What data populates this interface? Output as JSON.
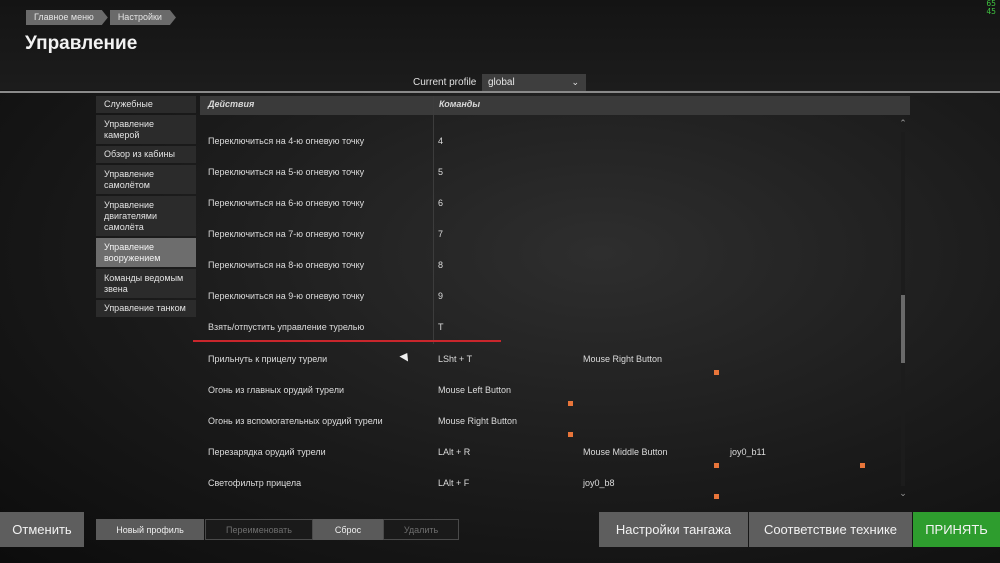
{
  "breadcrumbs": [
    "Главное меню",
    "Настройки"
  ],
  "page_title": "Управление",
  "fps_counter": [
    "65",
    "45"
  ],
  "profile": {
    "label": "Current profile",
    "value": "global"
  },
  "sidebar": {
    "items": [
      {
        "label": "Служебные",
        "active": false
      },
      {
        "label": "Управление камерой",
        "active": false
      },
      {
        "label": "Обзор из кабины",
        "active": false
      },
      {
        "label": "Управление самолётом",
        "active": false
      },
      {
        "label": "Управление двигателями самолёта",
        "active": false
      },
      {
        "label": "Управление вооружением",
        "active": true
      },
      {
        "label": "Команды ведомым звена",
        "active": false
      },
      {
        "label": "Управление танком",
        "active": false
      }
    ]
  },
  "table": {
    "headers": {
      "actions": "Действия",
      "commands": "Команды"
    },
    "rows": [
      {
        "action": "Переключиться на 4-ю огневую точку",
        "cmd1": "4",
        "cmd2": "",
        "cmd3": ""
      },
      {
        "action": "Переключиться на 5-ю огневую точку",
        "cmd1": "5",
        "cmd2": "",
        "cmd3": ""
      },
      {
        "action": "Переключиться на 6-ю огневую точку",
        "cmd1": "6",
        "cmd2": "",
        "cmd3": ""
      },
      {
        "action": "Переключиться на 7-ю огневую точку",
        "cmd1": "7",
        "cmd2": "",
        "cmd3": ""
      },
      {
        "action": "Переключиться на 8-ю огневую точку",
        "cmd1": "8",
        "cmd2": "",
        "cmd3": ""
      },
      {
        "action": "Переключиться на 9-ю огневую точку",
        "cmd1": "9",
        "cmd2": "",
        "cmd3": ""
      },
      {
        "action": "Взять/отпустить управление турелью",
        "cmd1": "T",
        "cmd2": "",
        "cmd3": ""
      },
      {
        "action": "Прильнуть к прицелу турели",
        "cmd1": "LSht + T",
        "cmd2": "Mouse Right Button",
        "cmd3": ""
      },
      {
        "action": "Огонь из главных орудий турели",
        "cmd1": "Mouse Left Button",
        "cmd2": "",
        "cmd3": ""
      },
      {
        "action": "Огонь из вспомогательных орудий турели",
        "cmd1": "Mouse Right Button",
        "cmd2": "",
        "cmd3": ""
      },
      {
        "action": "Перезарядка орудий турели",
        "cmd1": "LAlt + R",
        "cmd2": "Mouse Middle Button",
        "cmd3": "joy0_b11"
      },
      {
        "action": "Светофильтр прицела",
        "cmd1": "LAlt + F",
        "cmd2": "joy0_b8",
        "cmd3": ""
      }
    ]
  },
  "buttons": {
    "cancel": "Отменить",
    "new_profile": "Новый профиль",
    "rename": "Переименовать",
    "reset": "Сброс",
    "delete": "Удалить",
    "pitch_settings": "Настройки тангажа",
    "vehicle_match": "Соответствие технике",
    "accept": "ПРИНЯТЬ"
  },
  "colors": {
    "accent_green": "#2e9d2e",
    "highlight_red": "#c9262c",
    "marker_orange": "#e8753a"
  }
}
